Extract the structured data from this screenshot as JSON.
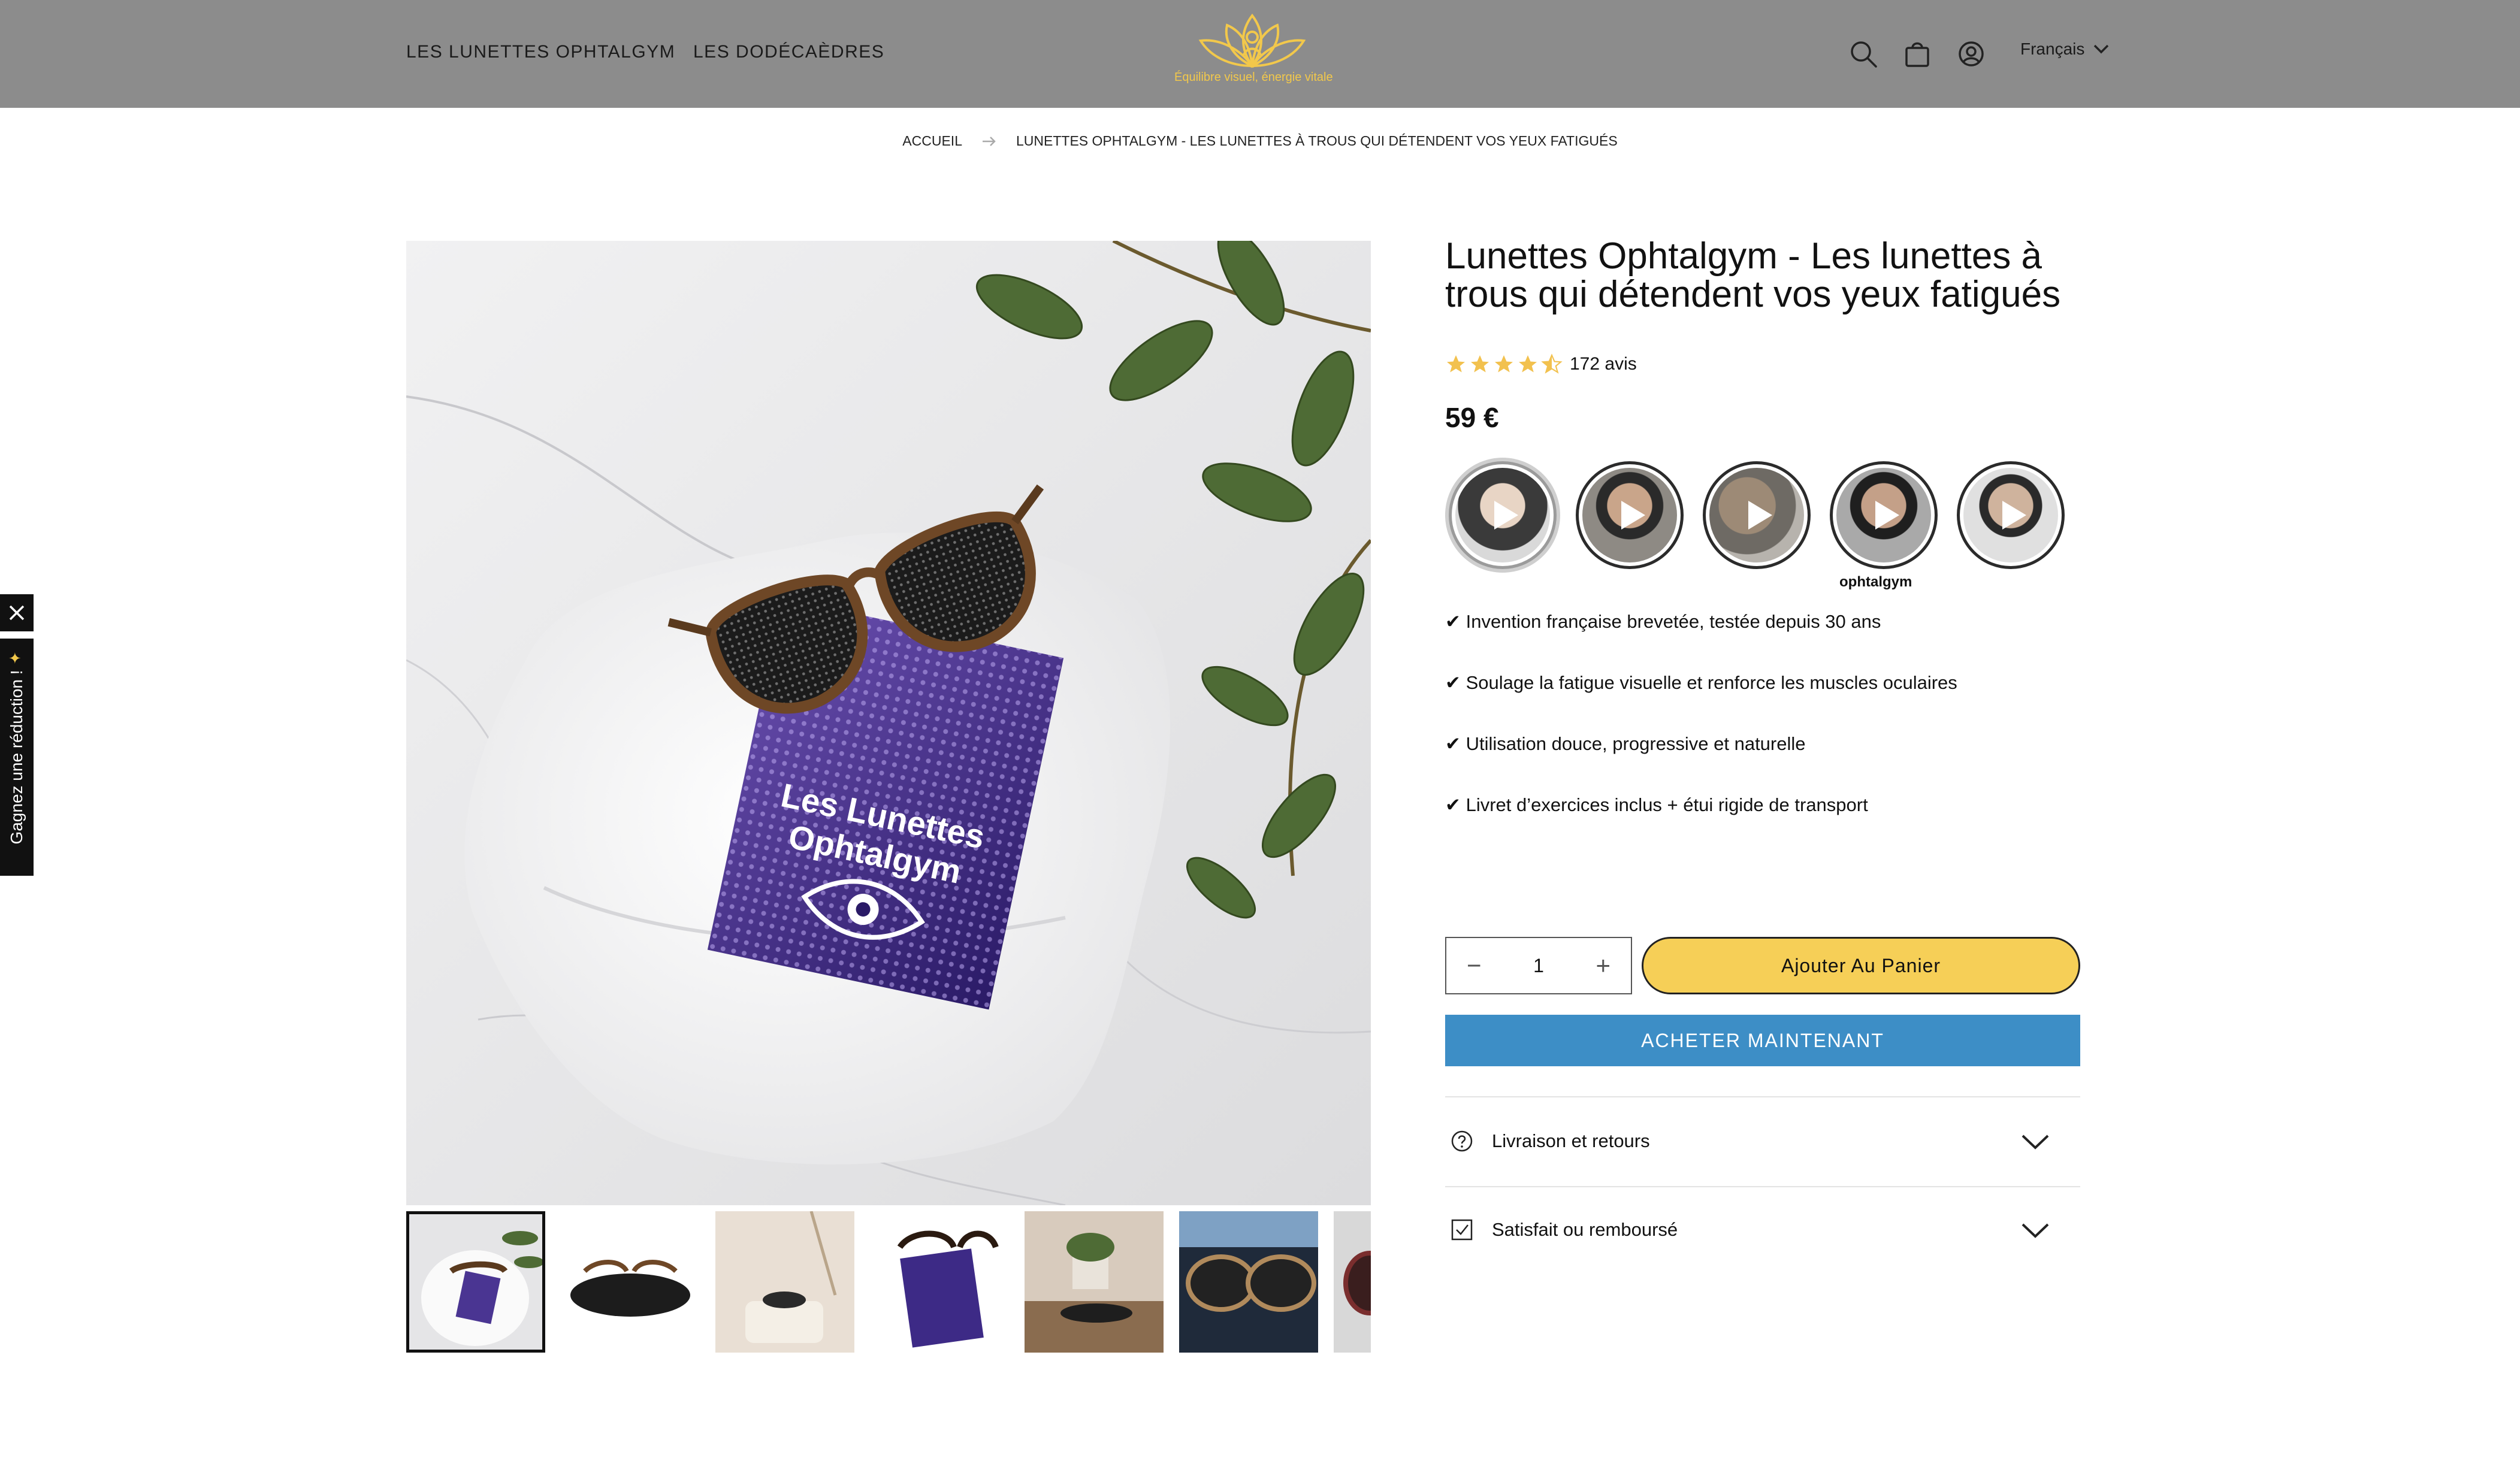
{
  "header": {
    "nav": [
      "LES LUNETTES OPHTALGYM",
      "LES DODÉCAÈDRES"
    ],
    "logo_tagline": "Équilibre visuel, énergie vitale",
    "language": "Français",
    "icons": [
      "search-icon",
      "cart-icon",
      "account-icon",
      "chevron-down-icon"
    ]
  },
  "breadcrumb": {
    "home": "ACCUEIL",
    "current": "LUNETTES OPHTALGYM - LES LUNETTES À TROUS QUI DÉTENDENT VOS YEUX FATIGUÉS"
  },
  "product": {
    "title": "Lunettes Ophtalgym - Les lunettes à trous qui détendent vos yeux fatigués",
    "rating": 4.5,
    "review_count": "172 avis",
    "price": "59 €",
    "video_caption": "ophtalgym",
    "video_count": 5,
    "thumbnail_count": 7,
    "benefits": [
      "✔ Invention française brevetée, testée depuis 30 ans",
      "✔ Soulage la fatigue visuelle et renforce les muscles oculaires",
      "✔ Utilisation douce, progressive et naturelle",
      "✔ Livret d’exercices inclus + étui rigide de transport"
    ],
    "main_image_box_text": [
      "Les Lunettes",
      "Ophtalgym"
    ]
  },
  "purchase": {
    "quantity": "1",
    "add_to_cart": "Ajouter Au Panier",
    "buy_now": "ACHETER MAINTENANT"
  },
  "accordion": {
    "shipping": "Livraison et retours",
    "guarantee": "Satisfait ou remboursé"
  },
  "promo": {
    "label": "Gagnez une réduction !"
  },
  "colors": {
    "header_bg": "#8c8c8c",
    "accent_yellow": "#f6cf57",
    "buy_blue": "#3d8ec6",
    "star": "#f2c14e"
  }
}
